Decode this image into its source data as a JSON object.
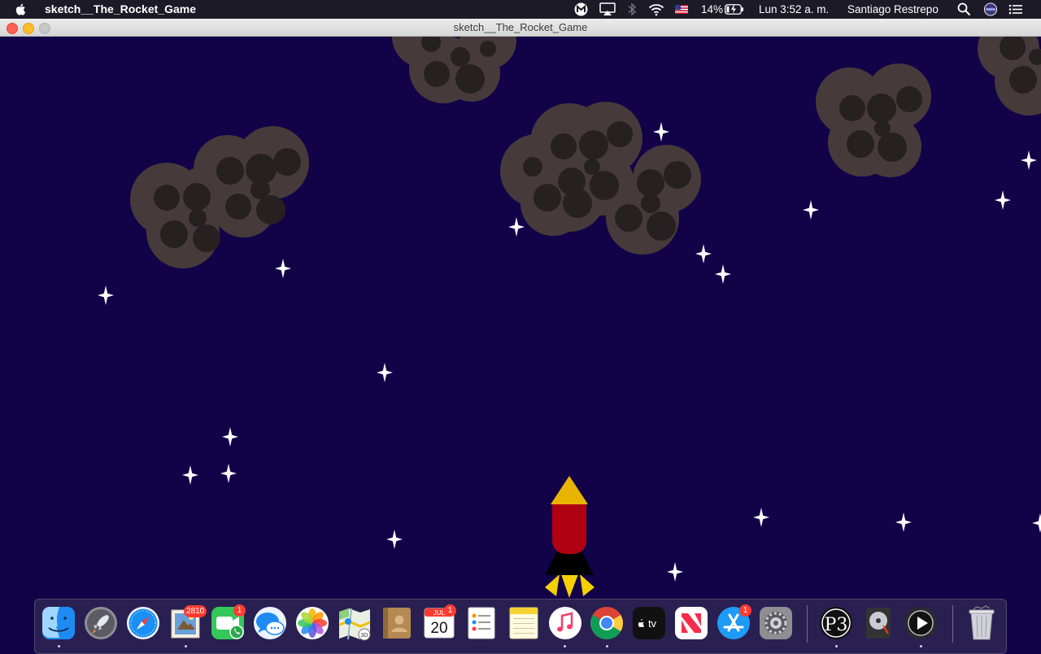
{
  "menubar": {
    "app_name": "sketch__The_Rocket_Game",
    "battery": "14%",
    "clock": "Lun 3:52 a. m.",
    "user": "Santiago Restrepo",
    "icons": [
      "apple-icon",
      "malwarebytes-icon",
      "airplay-icon",
      "bluetooth-icon",
      "wifi-icon",
      "us-flag-icon",
      "battery-charging-icon",
      "spotlight-search-icon",
      "siri-icon",
      "control-menu-icon"
    ]
  },
  "window": {
    "title": "sketch__The_Rocket_Game",
    "controls": [
      "close",
      "minimize",
      "zoom"
    ]
  },
  "game": {
    "colors": {
      "sky": "#120248",
      "asteroid": "#473a3a",
      "crater": "#272020",
      "star": "#ffffff",
      "rocket_body": "#b00012",
      "rocket_nose": "#e8b400",
      "rocket_base": "#000000",
      "flame": "#f4d000"
    }
  },
  "dock": {
    "apps": [
      {
        "name": "finder",
        "running": true
      },
      {
        "name": "launchpad",
        "running": false
      },
      {
        "name": "safari",
        "running": false
      },
      {
        "name": "mail",
        "badge": "2810",
        "running": true
      },
      {
        "name": "facetime",
        "badge": "1",
        "running": false
      },
      {
        "name": "messages",
        "running": false
      },
      {
        "name": "photos",
        "running": false
      },
      {
        "name": "maps",
        "running": false
      },
      {
        "name": "contacts",
        "running": false
      },
      {
        "name": "calendar",
        "badge": "1",
        "month": "JUL",
        "day": "20",
        "running": false
      },
      {
        "name": "reminders",
        "running": false
      },
      {
        "name": "notes",
        "running": false
      },
      {
        "name": "music",
        "running": true
      },
      {
        "name": "chrome",
        "running": true
      },
      {
        "name": "apple-tv",
        "label": "tv",
        "running": false
      },
      {
        "name": "news",
        "running": false
      },
      {
        "name": "app-store",
        "badge": "1",
        "running": false
      },
      {
        "name": "system-preferences",
        "running": false
      }
    ],
    "extra_apps": [
      {
        "name": "processing",
        "running": true
      },
      {
        "name": "disk-utility",
        "running": false
      },
      {
        "name": "quicktime",
        "running": true
      }
    ],
    "trash": {
      "name": "trash"
    }
  }
}
